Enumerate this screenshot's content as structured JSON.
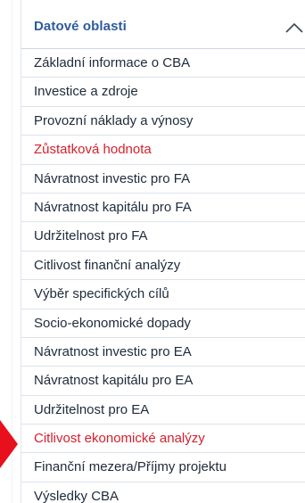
{
  "panel": {
    "title": "Datové oblasti",
    "collapse_icon": "chevron-up-icon",
    "accent_color": "#2d5c9e",
    "active_color": "#d6202d",
    "marker_color": "#e8101c",
    "items": [
      {
        "label": "Základní informace o CBA",
        "active": false
      },
      {
        "label": "Investice a zdroje",
        "active": false
      },
      {
        "label": "Provozní náklady a výnosy",
        "active": false
      },
      {
        "label": "Zůstatková hodnota",
        "active": true
      },
      {
        "label": "Návratnost investic pro FA",
        "active": false
      },
      {
        "label": "Návratnost kapitálu pro FA",
        "active": false
      },
      {
        "label": "Udržitelnost pro FA",
        "active": false
      },
      {
        "label": "Citlivost finanční analýzy",
        "active": false
      },
      {
        "label": "Výběr specifických cílů",
        "active": false
      },
      {
        "label": "Socio-ekonomické dopady",
        "active": false
      },
      {
        "label": "Návratnost investic pro EA",
        "active": false
      },
      {
        "label": "Návratnost kapitálu pro EA",
        "active": false
      },
      {
        "label": "Udržitelnost pro EA",
        "active": false
      },
      {
        "label": "Citlivost ekonomické analýzy",
        "active": true
      },
      {
        "label": "Finanční mezera/Příjmy projektu",
        "active": false
      },
      {
        "label": "Výsledky CBA",
        "active": false
      }
    ]
  }
}
